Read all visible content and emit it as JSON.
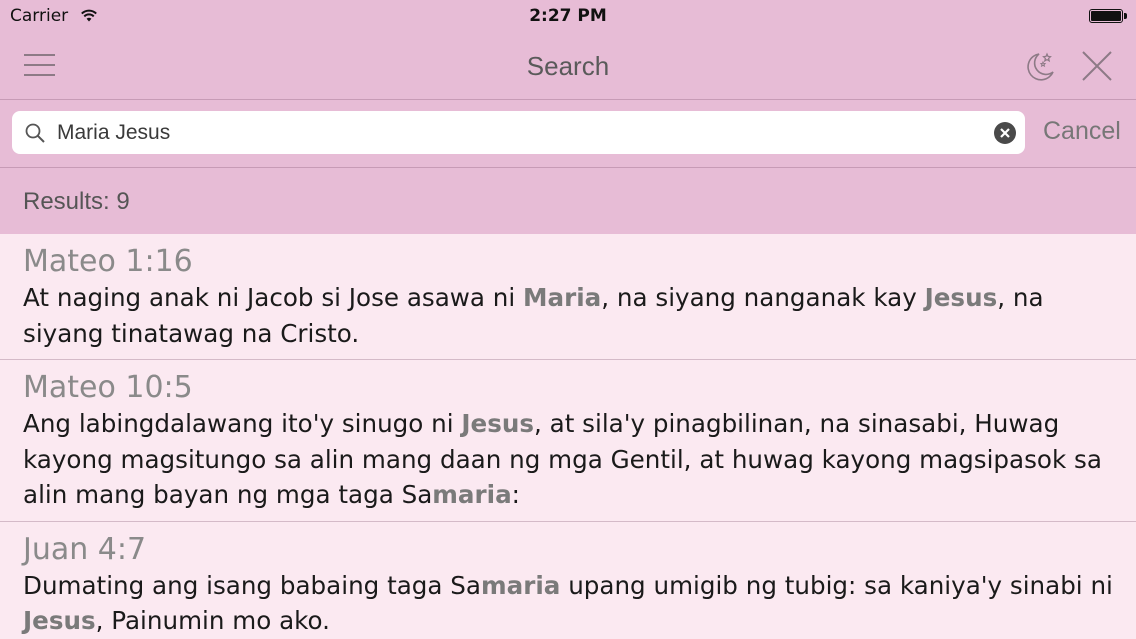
{
  "status_bar": {
    "carrier": "Carrier",
    "time": "2:27 PM",
    "battery_level": 1.0
  },
  "nav": {
    "title": "Search",
    "icons": [
      "menu-icon",
      "moon-stars-icon",
      "close-icon"
    ]
  },
  "search": {
    "value": "Maria Jesus",
    "placeholder": "",
    "cancel_label": "Cancel"
  },
  "results": {
    "summary": "Results: 9"
  },
  "items": [
    {
      "reference": "Mateo 1:16",
      "segments": [
        {
          "text": "At naging anak ni Jacob si Jose asawa ni ",
          "highlight": false
        },
        {
          "text": "Maria",
          "highlight": true
        },
        {
          "text": ", na siyang nanganak kay ",
          "highlight": false
        },
        {
          "text": "Jesus",
          "highlight": true
        },
        {
          "text": ", na siyang tinatawag na Cristo.",
          "highlight": false
        }
      ]
    },
    {
      "reference": "Mateo 10:5",
      "segments": [
        {
          "text": "Ang labingdalawang ito'y sinugo ni ",
          "highlight": false
        },
        {
          "text": "Jesus",
          "highlight": true
        },
        {
          "text": ", at sila'y pinagbilinan, na sinasabi, Huwag kayong magsitungo sa alin mang daan ng mga Gentil, at huwag kayong magsipasok sa alin mang bayan ng mga taga Sa",
          "highlight": false
        },
        {
          "text": "maria",
          "highlight": true
        },
        {
          "text": ":",
          "highlight": false
        }
      ]
    },
    {
      "reference": "Juan 4:7",
      "segments": [
        {
          "text": "Dumating ang isang babaing taga Sa",
          "highlight": false
        },
        {
          "text": "maria",
          "highlight": true
        },
        {
          "text": " upang umigib ng tubig: sa kaniya'y sinabi ni ",
          "highlight": false
        },
        {
          "text": "Jesus",
          "highlight": true
        },
        {
          "text": ", Painumin mo ako.",
          "highlight": false
        }
      ]
    }
  ],
  "colors": {
    "bar": "#e7bcd6",
    "list_bg": "#fbe9f1",
    "highlight": "#7a7a7a",
    "text": "#1a1a1a"
  }
}
